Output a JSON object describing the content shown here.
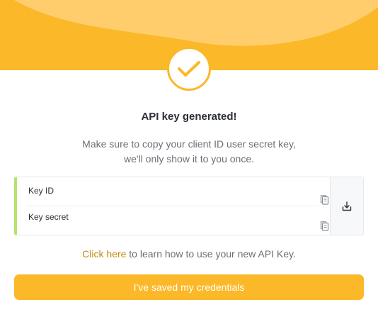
{
  "colors": {
    "accent": "#fbb829",
    "accent_light": "#ffcd6b",
    "link": "#c48a12",
    "card_accent_border": "#b6e26d"
  },
  "header": {
    "icon": "check-icon"
  },
  "dialog": {
    "title": "API key generated!",
    "subtitle_line1": "Make sure to copy your client ID user secret key,",
    "subtitle_line2": "we'll only show it to you once."
  },
  "credentials": {
    "key_id_label": "Key ID",
    "key_secret_label": "Key secret",
    "copy_icon": "copy-icon",
    "download_icon": "download-icon"
  },
  "help": {
    "link_text": "Click here",
    "rest_text": " to learn how to use your new API Key."
  },
  "actions": {
    "saved_label": "I've saved my credentials"
  }
}
